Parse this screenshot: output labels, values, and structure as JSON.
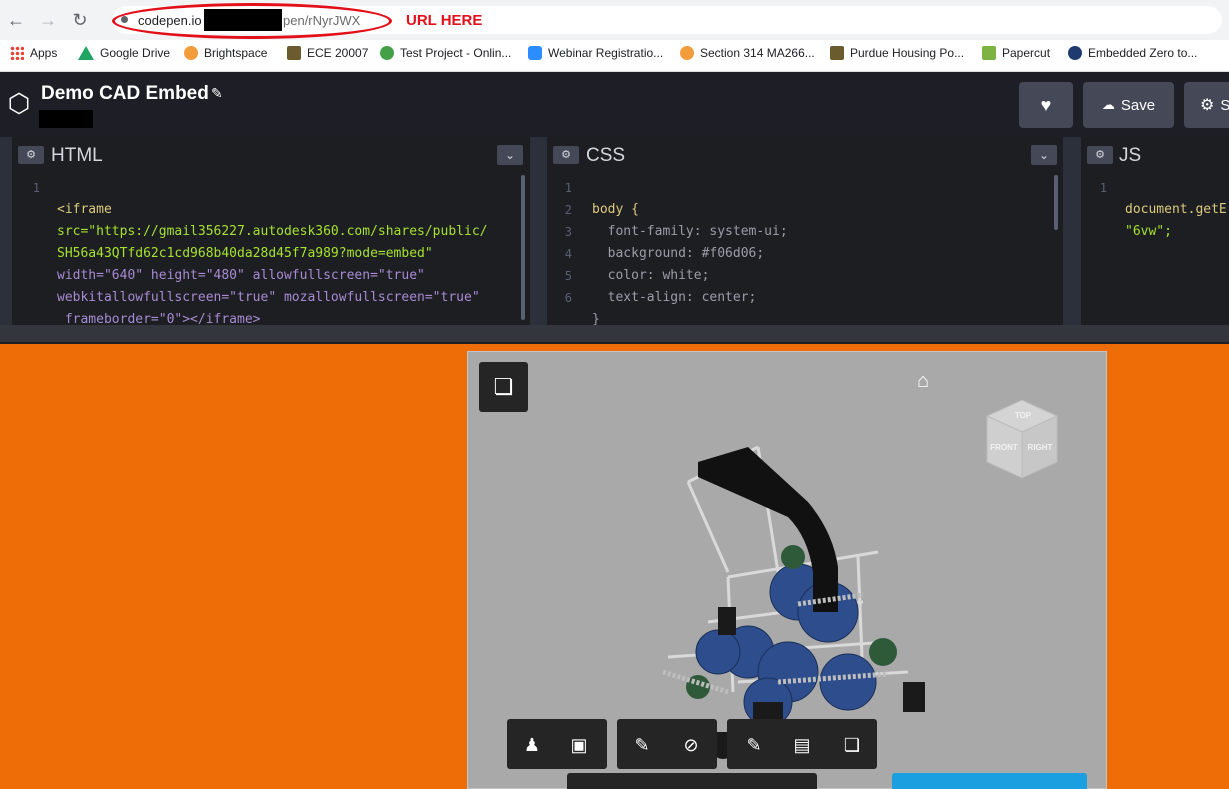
{
  "browser": {
    "url_visible": "codepen.io",
    "url_path": "pen/rNyrJWX",
    "annotation": "URL HERE"
  },
  "bookmarks": [
    {
      "label": "Apps",
      "icon": "apps-grid-icon",
      "color": "#e94235"
    },
    {
      "label": "Google Drive",
      "icon": "google-drive-icon",
      "color": "#1fa463"
    },
    {
      "label": "Brightspace",
      "icon": "brightspace-icon",
      "color": "#f39c3c"
    },
    {
      "label": "ECE 20007",
      "icon": "purdue-icon",
      "color": "#6b5b2e"
    },
    {
      "label": "Test Project - Onlin...",
      "icon": "leaf-icon",
      "color": "#43a047"
    },
    {
      "label": "Webinar Registratio...",
      "icon": "zoom-icon",
      "color": "#2d8cff"
    },
    {
      "label": "Section 314 MA266...",
      "icon": "brightspace-icon",
      "color": "#f39c3c"
    },
    {
      "label": "Purdue Housing Po...",
      "icon": "purdue-icon",
      "color": "#6b5b2e"
    },
    {
      "label": "Papercut",
      "icon": "papercut-icon",
      "color": "#7cb342"
    },
    {
      "label": "Embedded Zero to...",
      "icon": "embedded-icon",
      "color": "#1e3a6e"
    }
  ],
  "codepen": {
    "title": "Demo CAD Embed",
    "save_label": "Save",
    "settings_label": "S"
  },
  "panels": {
    "html": {
      "name": "HTML",
      "lines": [
        "1"
      ],
      "code": [
        "<iframe",
        "src=\"https://gmail356227.autodesk360.com/shares/public/",
        "SH56a43QTfd62c1cd968b40da28d45f7a989?mode=embed\"",
        "width=\"640\" height=\"480\" allowfullscreen=\"true\"",
        "webkitallowfullscreen=\"true\" mozallowfullscreen=\"true\"",
        " frameborder=\"0\"></iframe>"
      ]
    },
    "css": {
      "name": "CSS",
      "lines": [
        "1",
        "2",
        "3",
        "4",
        "5",
        "6"
      ],
      "code": [
        "body {",
        "  font-family: system-ui;",
        "  background: #f06d06;",
        "  color: white;",
        "  text-align: center;",
        "}"
      ]
    },
    "js": {
      "name": "JS",
      "lines": [
        "1"
      ],
      "code": [
        "document.getE",
        "\"6vw\";"
      ]
    }
  },
  "colors": {
    "result_bg": "#ef6d06",
    "viewer_bg": "#a9a9a9",
    "editor_bg": "#1d1e22",
    "annotation": "#e3101a"
  },
  "viewcube": {
    "top": "TOP",
    "front": "FRONT",
    "right": "RIGHT"
  },
  "toolbar_icons": [
    "walk-person-icon",
    "camera-icon",
    "markup-pen-icon",
    "eye-hidden-icon",
    "measure-ruler-icon",
    "folder-icon",
    "model-cube-icon"
  ]
}
